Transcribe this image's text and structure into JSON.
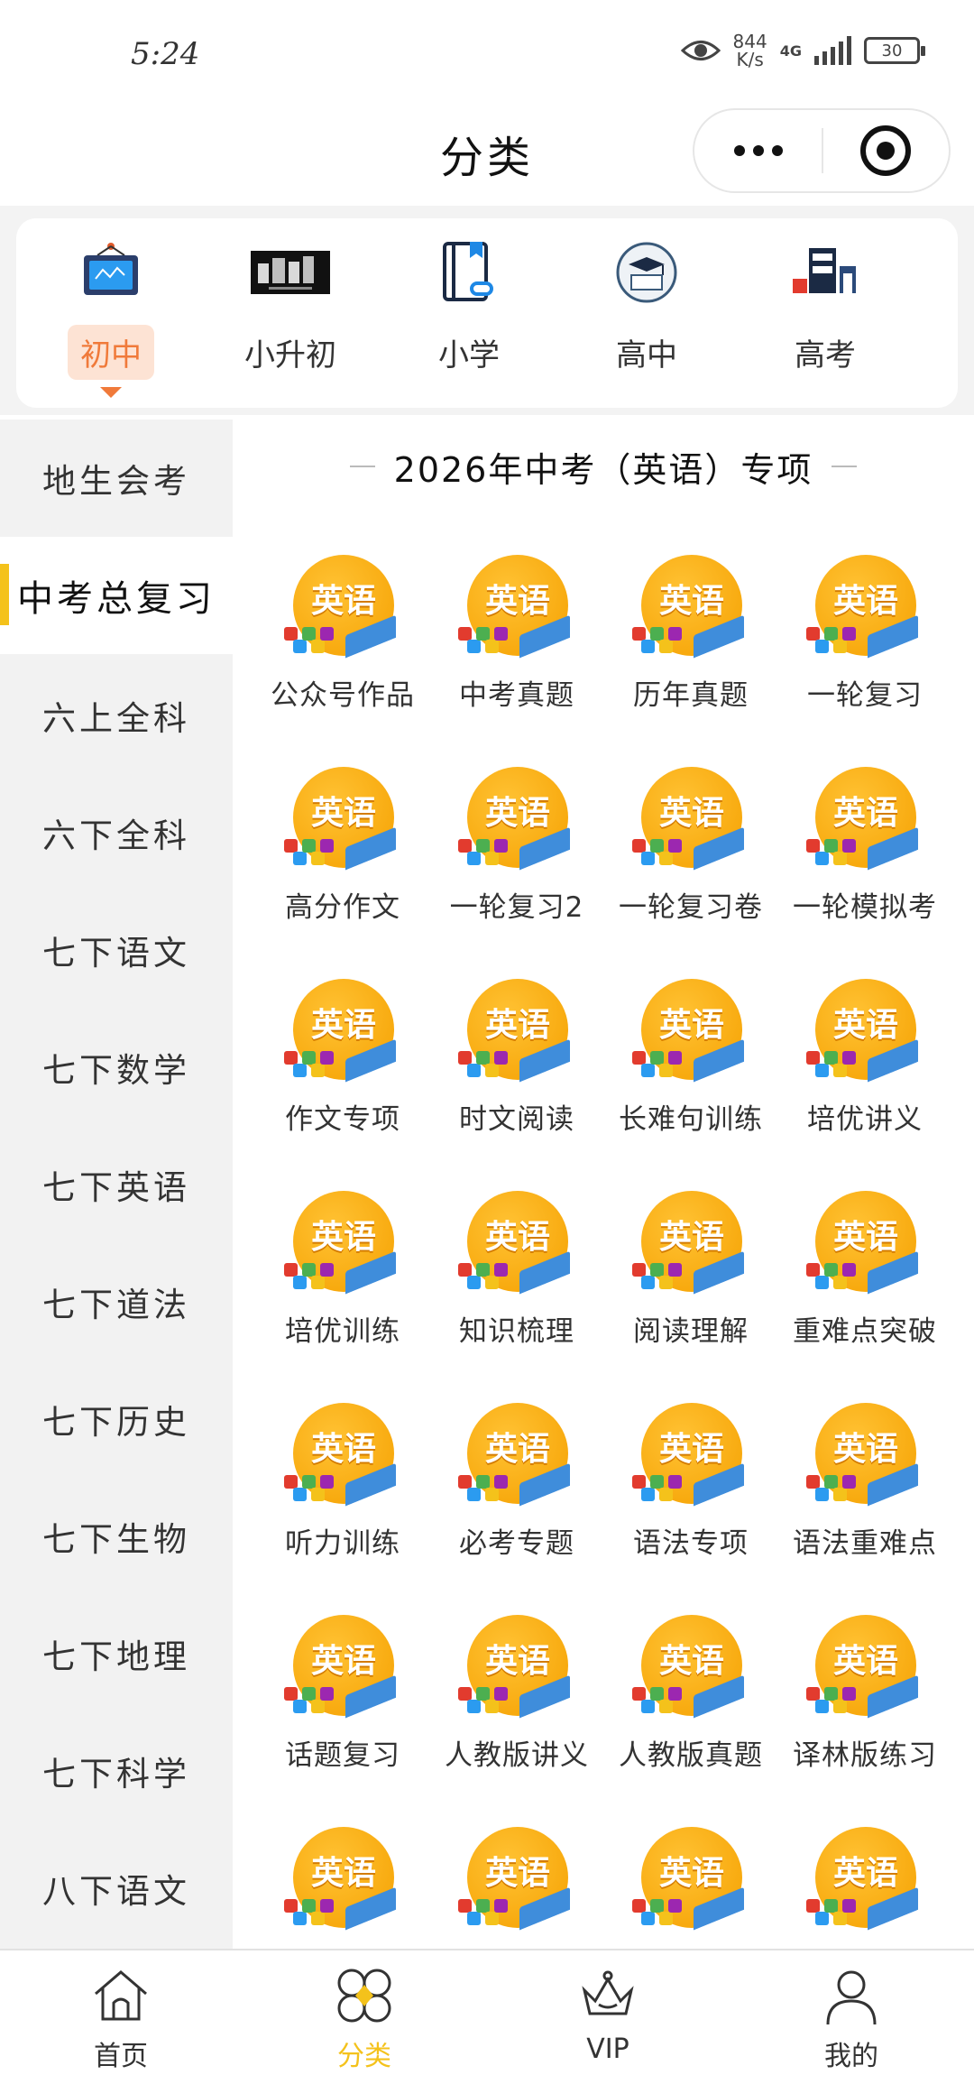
{
  "status_bar": {
    "time": "5:24",
    "net_speed_value": "844",
    "net_speed_unit": "K/s",
    "network": "4G",
    "battery": "30"
  },
  "header": {
    "title": "分类"
  },
  "levels": [
    {
      "label": "初中",
      "icon": "whiteboard-icon",
      "active": true
    },
    {
      "label": "小升初",
      "icon": "banner-image-icon",
      "active": false
    },
    {
      "label": "小学",
      "icon": "notebook-link-icon",
      "active": false
    },
    {
      "label": "高中",
      "icon": "graduation-cap-icon",
      "active": false
    },
    {
      "label": "高考",
      "icon": "gaokao-logo-icon",
      "active": false
    }
  ],
  "sidebar": {
    "items": [
      {
        "label": "地生会考"
      },
      {
        "label": "中考总复习"
      },
      {
        "label": "六上全科"
      },
      {
        "label": "六下全科"
      },
      {
        "label": "七下语文"
      },
      {
        "label": "七下数学"
      },
      {
        "label": "七下英语"
      },
      {
        "label": "七下道法"
      },
      {
        "label": "七下历史"
      },
      {
        "label": "七下生物"
      },
      {
        "label": "七下地理"
      },
      {
        "label": "七下科学"
      },
      {
        "label": "八下语文"
      }
    ],
    "active_index": 1
  },
  "section": {
    "title": "2026年中考（英语）专项"
  },
  "grid": {
    "icon_text": "英语",
    "items": [
      {
        "label": "公众号作品"
      },
      {
        "label": "中考真题"
      },
      {
        "label": "历年真题"
      },
      {
        "label": "一轮复习"
      },
      {
        "label": "高分作文"
      },
      {
        "label": "一轮复习2"
      },
      {
        "label": "一轮复习卷"
      },
      {
        "label": "一轮模拟考"
      },
      {
        "label": "作文专项"
      },
      {
        "label": "时文阅读"
      },
      {
        "label": "长难句训练"
      },
      {
        "label": "培优讲义"
      },
      {
        "label": "培优训练"
      },
      {
        "label": "知识梳理"
      },
      {
        "label": "阅读理解"
      },
      {
        "label": "重难点突破"
      },
      {
        "label": "听力训练"
      },
      {
        "label": "必考专题"
      },
      {
        "label": "语法专项"
      },
      {
        "label": "语法重难点"
      },
      {
        "label": "话题复习"
      },
      {
        "label": "人教版讲义"
      },
      {
        "label": "人教版真题"
      },
      {
        "label": "译林版练习"
      },
      {
        "label": ""
      },
      {
        "label": ""
      },
      {
        "label": ""
      },
      {
        "label": ""
      }
    ]
  },
  "bottom_nav": [
    {
      "label": "首页",
      "icon": "home-icon",
      "active": false
    },
    {
      "label": "分类",
      "icon": "category-icon",
      "active": true
    },
    {
      "label": "VIP",
      "icon": "crown-icon",
      "active": false
    },
    {
      "label": "我的",
      "icon": "user-icon",
      "active": false
    }
  ],
  "colors": {
    "accent_orange": "#f07a3a",
    "accent_yellow": "#f4c21b",
    "icon_orange": "#f5a000",
    "sidebar_bg": "#f2f2f2"
  }
}
